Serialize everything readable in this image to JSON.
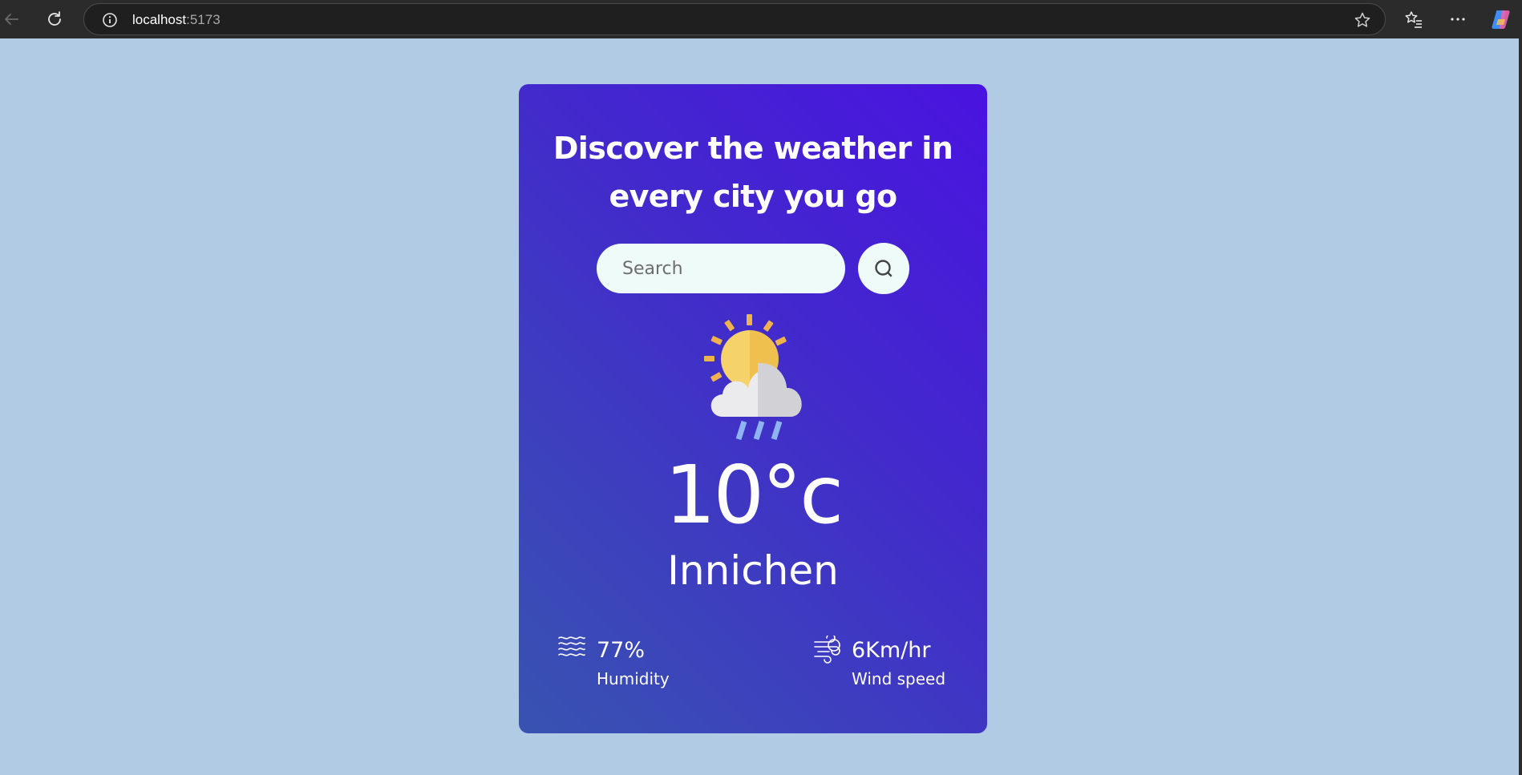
{
  "browser": {
    "url_host": "localhost",
    "url_port": ":5173",
    "back_icon": "back-arrow-icon",
    "reload_icon": "reload-icon",
    "info_icon": "info-icon",
    "star_icon": "star-icon",
    "favorites_icon": "favorites-icon",
    "menu_icon": "more-icon",
    "copilot_icon": "copilot-icon"
  },
  "colors": {
    "page_background": "#b0cbe3",
    "card_gradient_start": "#4a13e0",
    "card_gradient_end": "#3853b1",
    "input_background": "#eefbf8"
  },
  "weather": {
    "heading": "Discover the weather in every city you go",
    "search_placeholder": "Search",
    "search_icon": "search-icon",
    "condition_icon": "sun-cloud-rain-icon",
    "temperature": "10°c",
    "city": "Innichen",
    "humidity": {
      "icon": "humidity-waves-icon",
      "value": "77%",
      "label": "Humidity"
    },
    "wind": {
      "icon": "wind-icon",
      "value": "6Km/hr",
      "label": "Wind speed"
    }
  }
}
